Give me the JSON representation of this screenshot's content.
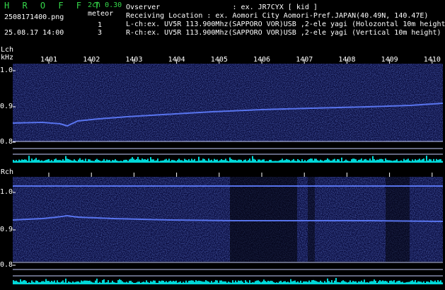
{
  "header": {
    "brand": "H R O F F T",
    "version": "2ch 0.30",
    "filename": "2508171400.png",
    "meteor_label": "meteor",
    "meteor_lch": "1",
    "meteor_rch": "3",
    "datetime": "25.08.17 14:00",
    "observer_line": "Ovserver                 : ex. JR7CYX [ kid ]",
    "location_line": "Receiving Location : ex. Aomori City Aomori-Pref.JAPAN(40.49N, 140.47E)",
    "lch_line": "L-ch:ex. UV5R 113.900Mhz(SAPPORO VOR)USB ,2-ele yagi (Holozontal 10m height)",
    "rch_line": "R-ch:ex. UV5R 113.900Mhz(SAPPORO VOR)USB ,2-ele yagi (Vertical 10m height)"
  },
  "x_ticks": [
    "1401",
    "1402",
    "1403",
    "1404",
    "1405",
    "1406",
    "1407",
    "1408",
    "1409",
    "1410"
  ],
  "lch": {
    "label": "Lch",
    "unit": "kHz",
    "y_ticks": [
      "1.0",
      "0.9",
      "0.8"
    ]
  },
  "rch": {
    "label": "Rch",
    "y_ticks": [
      "1.0",
      "0.9",
      "0.8"
    ]
  },
  "colors": {
    "background": "#000000",
    "noise": "#1d2a8a",
    "signal": "#5f7dff",
    "level_bar": "#00d8d8",
    "header_green": "#35d74a",
    "grid_line": "#c9d0ff"
  }
}
